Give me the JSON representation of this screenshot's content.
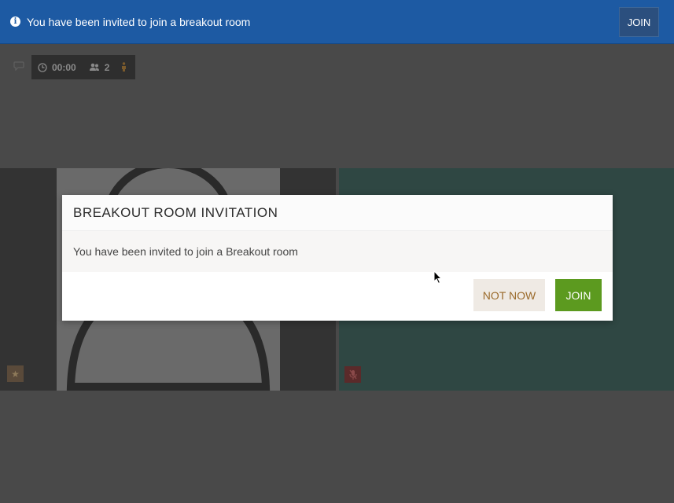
{
  "notification": {
    "info_icon": "info-icon",
    "text": "You have been invited to join a breakout room",
    "join_label": "JOIN"
  },
  "toolbar": {
    "chat_icon": "chat-icon",
    "timer": "00:00",
    "participants": "2"
  },
  "dialog": {
    "title": "BREAKOUT ROOM INVITATION",
    "message": "You have been invited to join a Breakout room",
    "not_now_label": "NOT NOW",
    "join_label": "JOIN"
  },
  "colors": {
    "notification_bar": "#1d5aa3",
    "join_primary": "#5c9a1f",
    "not_now_text": "#9a6a2a"
  }
}
